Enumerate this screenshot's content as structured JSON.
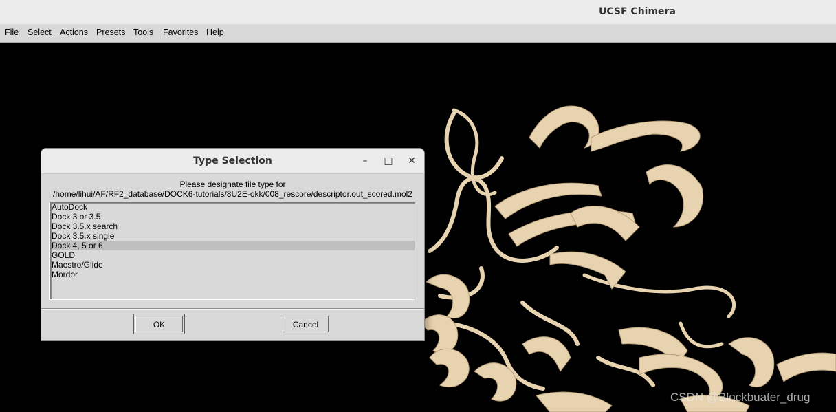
{
  "window": {
    "title": "UCSF Chimera"
  },
  "menu": {
    "items": [
      {
        "label": "File"
      },
      {
        "label": "Select"
      },
      {
        "label": "Actions"
      },
      {
        "label": "Presets"
      },
      {
        "label": "Tools"
      },
      {
        "label": "Favorites"
      },
      {
        "label": "Help"
      }
    ]
  },
  "viewport": {
    "background": "#000000",
    "ribbon_color": "#e8d3b0"
  },
  "watermark": "CSDN @Blockbuater_drug",
  "dialog": {
    "title": "Type Selection",
    "controls": {
      "minimize": "–",
      "maximize": "□",
      "close": "✕"
    },
    "prompt_line1": "Please designate file type for",
    "prompt_line2": "/home/lihui/AF/RF2_database/DOCK6-tutorials/8U2E-okk/008_rescore/descriptor.out_scored.mol2",
    "types": [
      "AutoDock",
      "Dock 3 or 3.5",
      "Dock 3.5.x search",
      "Dock 3.5.x single",
      "Dock 4, 5 or 6",
      "GOLD",
      "Maestro/Glide",
      "Mordor"
    ],
    "selected_type": "Dock 4, 5 or 6",
    "ok_label": "OK",
    "cancel_label": "Cancel"
  }
}
